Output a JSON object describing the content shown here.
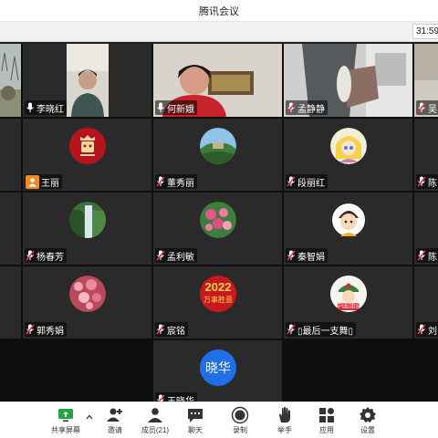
{
  "window": {
    "title": "腾讯会议",
    "timer": "31:59"
  },
  "participants": [
    {
      "name": "李晓红"
    },
    {
      "name": "何新娥"
    },
    {
      "name": "孟静静"
    },
    {
      "name": "吴"
    },
    {
      "name": "王丽"
    },
    {
      "name": "董秀丽"
    },
    {
      "name": "段丽红"
    },
    {
      "name": "陈"
    },
    {
      "name": "杨春芳"
    },
    {
      "name": "孟利敏"
    },
    {
      "name": "秦智娟"
    },
    {
      "name": "陈"
    },
    {
      "name": "郭秀娟"
    },
    {
      "name": "宸铭"
    },
    {
      "name": "▯最后一支舞▯"
    },
    {
      "name": "刘"
    },
    {
      "name": "王晓华",
      "avatar_text": "晓华"
    }
  ],
  "avatar_texts": {
    "year": "2022",
    "slogan": "万事胜意",
    "china": "中国加油"
  },
  "toolbar": {
    "share": "共享屏幕",
    "invite": "邀请",
    "members": "成员(21)",
    "chat": "聊天",
    "record": "录制",
    "raise_hand": "举手",
    "apps": "应用",
    "settings": "设置"
  },
  "colors": {
    "active_border": "#27c24c",
    "mute_red": "#e0393e",
    "avatar_blue": "#1e6fe8",
    "tile_bg": "#2a2a2a"
  }
}
